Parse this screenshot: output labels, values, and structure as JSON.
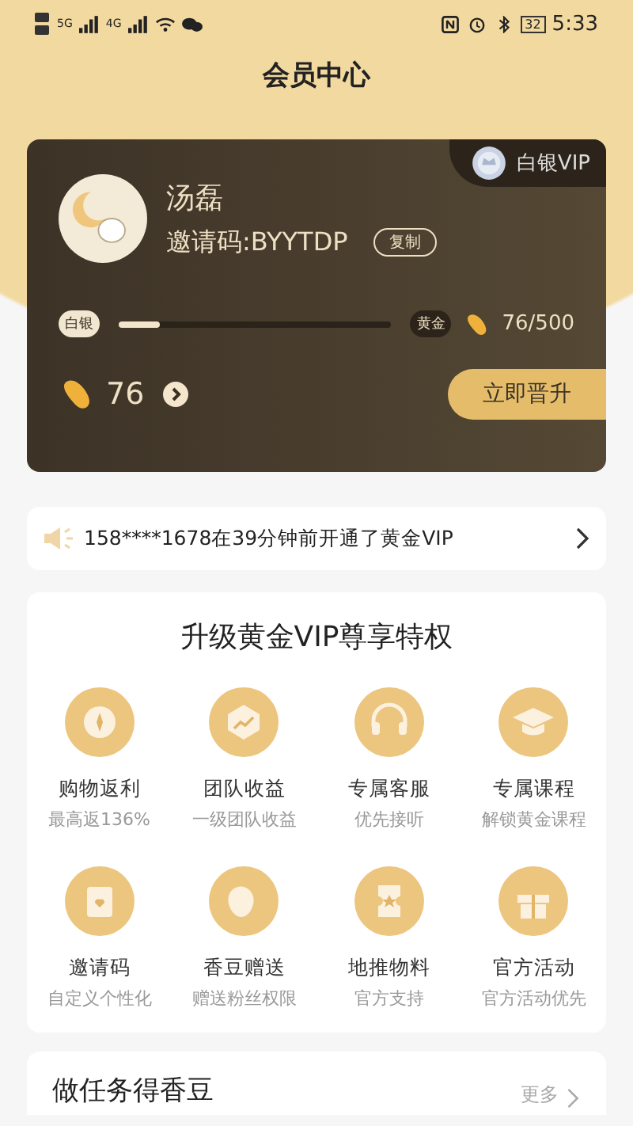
{
  "status_bar": {
    "network_left": "5G",
    "network_right": "4G",
    "battery": "32",
    "time": "5:33"
  },
  "header": {
    "title": "会员中心"
  },
  "member_card": {
    "level_badge": "白银VIP",
    "name": "汤磊",
    "invite_code": "邀请码:BYYTDP",
    "copy_button": "复制",
    "progress": {
      "from": "白银",
      "to": "黄金",
      "level": 0.15,
      "reading": "76/500"
    },
    "beans": "76",
    "upgrade_button": "立即晋升"
  },
  "notice": {
    "text": "158****1678在39分钟前开通了黄金VIP"
  },
  "privileges": {
    "title": "升级黄金VIP尊享特权",
    "items": [
      {
        "title": "购物返利",
        "subtitle": "最高返136%"
      },
      {
        "title": "团队收益",
        "subtitle": "一级团队收益"
      },
      {
        "title": "专属客服",
        "subtitle": "优先接听"
      },
      {
        "title": "专属课程",
        "subtitle": "解锁黄金课程"
      },
      {
        "title": "邀请码",
        "subtitle": "自定义个性化"
      },
      {
        "title": "香豆赠送",
        "subtitle": "赠送粉丝权限"
      },
      {
        "title": "地推物料",
        "subtitle": "官方支持"
      },
      {
        "title": "官方活动",
        "subtitle": "官方活动优先"
      }
    ]
  },
  "tasks": {
    "title": "做任务得香豆",
    "more": "更多"
  }
}
